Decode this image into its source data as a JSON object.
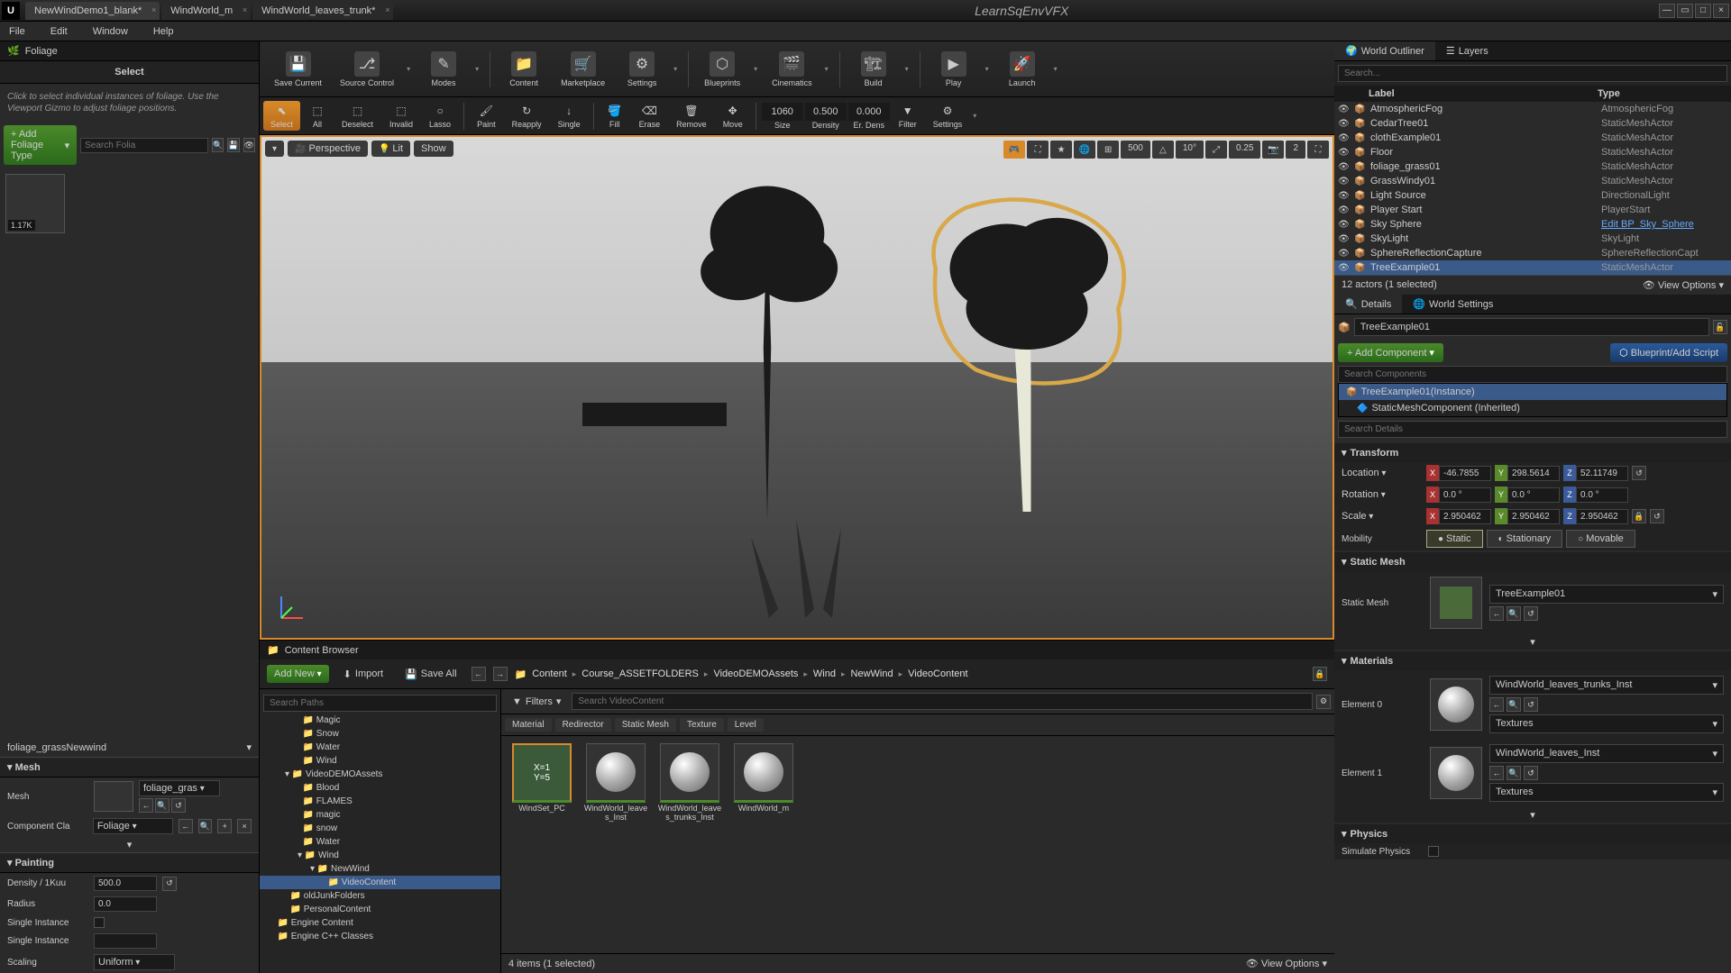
{
  "titlebar": {
    "tabs": [
      "NewWindDemo1_blank*",
      "WindWorld_m",
      "WindWorld_leaves_trunk*"
    ],
    "brand": "LearnSqEnvVFX"
  },
  "menu": [
    "File",
    "Edit",
    "Window",
    "Help"
  ],
  "foliage": {
    "title": "Foliage",
    "select": "Select",
    "help": "Click to select individual instances of foliage. Use the Viewport Gizmo to adjust foliage positions.",
    "addBtn": "+ Add Foliage Type",
    "searchPh": "Search Folia",
    "thumbBadge": "1.17K",
    "selected": "foliage_grassNewwind",
    "mesh": {
      "hdr": "Mesh",
      "label": "Mesh",
      "value": "foliage_gras",
      "compLabel": "Component Cla",
      "compValue": "Foliage"
    },
    "paint": {
      "hdr": "Painting",
      "density": "Density / 1Kuu",
      "densityVal": "500.0",
      "radius": "Radius",
      "radiusVal": "0.0",
      "single": "Single Instance",
      "single2": "Single Instance",
      "scaling": "Scaling",
      "scalingVal": "Uniform"
    }
  },
  "toolbar": {
    "items": [
      "Save Current",
      "Source Control",
      "Modes",
      "Content",
      "Marketplace",
      "Settings",
      "Blueprints",
      "Cinematics",
      "Build",
      "Play",
      "Launch"
    ]
  },
  "subToolbar": {
    "items": [
      "Select",
      "All",
      "Deselect",
      "Invalid",
      "Lasso",
      "Paint",
      "Reapply",
      "Single",
      "Fill",
      "Erase",
      "Remove",
      "Move"
    ],
    "size": "Size",
    "sizeVal": "1060",
    "density": "Density",
    "densityVal": "0.500",
    "erDens": "Er. Dens",
    "erDensVal": "0.000",
    "filter": "Filter",
    "settings": "Settings"
  },
  "viewport": {
    "perspective": "Perspective",
    "lit": "Lit",
    "show": "Show",
    "gridVal": "500",
    "angleVal": "10°",
    "scaleVal": "0.25",
    "speedVal": "2"
  },
  "contentBrowser": {
    "title": "Content Browser",
    "addNew": "Add New",
    "import": "Import",
    "saveAll": "Save All",
    "path": [
      "Content",
      "Course_ASSETFOLDERS",
      "VideoDEMOAssets",
      "Wind",
      "NewWind",
      "VideoContent"
    ],
    "searchPathsPh": "Search Paths",
    "tree": [
      {
        "label": "Magic",
        "depth": 3
      },
      {
        "label": "Snow",
        "depth": 3
      },
      {
        "label": "Water",
        "depth": 3
      },
      {
        "label": "Wind",
        "depth": 3
      },
      {
        "label": "VideoDEMOAssets",
        "depth": 2,
        "exp": true
      },
      {
        "label": "Blood",
        "depth": 3
      },
      {
        "label": "FLAMES",
        "depth": 3
      },
      {
        "label": "magic",
        "depth": 3
      },
      {
        "label": "snow",
        "depth": 3
      },
      {
        "label": "Water",
        "depth": 3
      },
      {
        "label": "Wind",
        "depth": 3,
        "exp": true
      },
      {
        "label": "NewWind",
        "depth": 4,
        "exp": true
      },
      {
        "label": "VideoContent",
        "depth": 5,
        "sel": true
      },
      {
        "label": "oldJunkFolders",
        "depth": 2
      },
      {
        "label": "PersonalContent",
        "depth": 2
      },
      {
        "label": "Engine Content",
        "depth": 1
      },
      {
        "label": "Engine C++ Classes",
        "depth": 1
      }
    ],
    "filters": "Filters",
    "searchContentPh": "Search VideoContent",
    "filterTags": [
      "Material",
      "Redirector",
      "Static Mesh",
      "Texture",
      "Level"
    ],
    "assets": [
      {
        "name": "WindSet_PC",
        "badge": "X=1\nY=5",
        "sel": true
      },
      {
        "name": "WindWorld_leaves_Inst"
      },
      {
        "name": "WindWorld_leaves_trunks_Inst"
      },
      {
        "name": "WindWorld_m"
      }
    ],
    "status": "4 items (1 selected)",
    "viewOpts": "View Options"
  },
  "outliner": {
    "tab1": "World Outliner",
    "tab2": "Layers",
    "searchPh": "Search...",
    "cols": {
      "label": "Label",
      "type": "Type"
    },
    "rows": [
      {
        "label": "AtmosphericFog",
        "type": "AtmosphericFog"
      },
      {
        "label": "CedarTree01",
        "type": "StaticMeshActor"
      },
      {
        "label": "clothExample01",
        "type": "StaticMeshActor"
      },
      {
        "label": "Floor",
        "type": "StaticMeshActor"
      },
      {
        "label": "foliage_grass01",
        "type": "StaticMeshActor"
      },
      {
        "label": "GrassWindy01",
        "type": "StaticMeshActor"
      },
      {
        "label": "Light Source",
        "type": "DirectionalLight"
      },
      {
        "label": "Player Start",
        "type": "PlayerStart"
      },
      {
        "label": "Sky Sphere",
        "type": "Edit BP_Sky_Sphere",
        "link": true
      },
      {
        "label": "SkyLight",
        "type": "SkyLight"
      },
      {
        "label": "SphereReflectionCapture",
        "type": "SphereReflectionCapt"
      },
      {
        "label": "TreeExample01",
        "type": "StaticMeshActor",
        "sel": true
      }
    ],
    "status": "12 actors (1 selected)",
    "viewOpts": "View Options"
  },
  "details": {
    "tab1": "Details",
    "tab2": "World Settings",
    "name": "TreeExample01",
    "addComp": "+ Add Component",
    "blueprint": "Blueprint/Add Script",
    "searchCompPh": "Search Components",
    "comps": [
      {
        "label": "TreeExample01(Instance)",
        "sel": true
      },
      {
        "label": "StaticMeshComponent (Inherited)"
      }
    ],
    "searchDetPh": "Search Details",
    "transform": {
      "hdr": "Transform",
      "loc": "Location",
      "locX": "-46.7855",
      "locY": "298.5614",
      "locZ": "52.11749",
      "rot": "Rotation",
      "rotX": "0.0 °",
      "rotY": "0.0 °",
      "rotZ": "0.0 °",
      "scl": "Scale",
      "sclX": "2.950462",
      "sclY": "2.950462",
      "sclZ": "2.950462",
      "mob": "Mobility",
      "mobStatic": "Static",
      "mobStationary": "Stationary",
      "mobMovable": "Movable"
    },
    "staticMesh": {
      "hdr": "Static Mesh",
      "label": "Static Mesh",
      "value": "TreeExample01"
    },
    "materials": {
      "hdr": "Materials",
      "elements": [
        {
          "label": "Element 0",
          "value": "WindWorld_leaves_trunks_Inst",
          "tex": "Textures"
        },
        {
          "label": "Element 1",
          "value": "WindWorld_leaves_Inst",
          "tex": "Textures"
        }
      ]
    },
    "physics": {
      "hdr": "Physics",
      "sim": "Simulate Physics"
    }
  }
}
